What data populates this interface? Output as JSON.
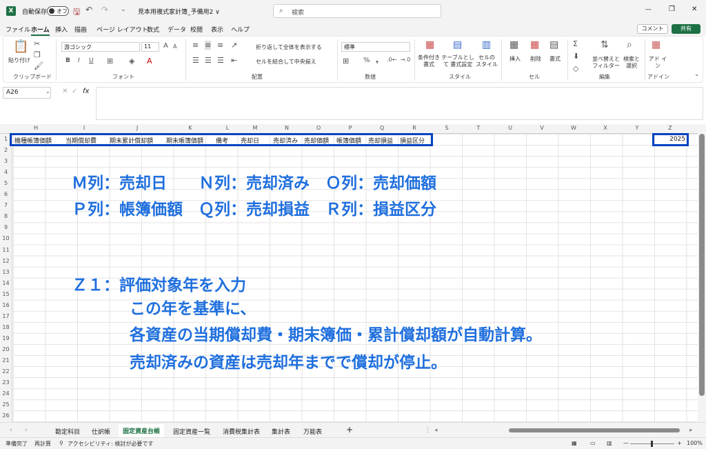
{
  "titlebar": {
    "app_icon": "X",
    "autosave_label": "自動保存",
    "toggle_state": "オフ",
    "file_title": "見本用複式家計簿_予備用2 ∨",
    "search_placeholder": "検索",
    "win_min": "—",
    "win_max": "❐",
    "win_close": "✕"
  },
  "menu": {
    "items": [
      "ファイル",
      "ホーム",
      "挿入",
      "描画",
      "ページ レイアウト",
      "数式",
      "データ",
      "校閲",
      "表示",
      "ヘルプ"
    ],
    "active": "ホーム",
    "comment_btn": "コメント",
    "share_btn": "共有"
  },
  "ribbon": {
    "clipboard": {
      "label": "クリップボード",
      "paste": "貼り付け"
    },
    "font": {
      "label": "フォント",
      "name": "游ゴシック",
      "size": "11",
      "bold": "B",
      "italic": "I",
      "underline": "U",
      "grow": "A",
      "shrink": "A"
    },
    "alignment": {
      "label": "配置",
      "wrap": "折り返して全体を表示する",
      "merge": "セルを結合して中央揃え"
    },
    "number": {
      "label": "数値",
      "format": "標準",
      "percent": "%",
      "comma": "❟"
    },
    "styles": {
      "label": "スタイル",
      "conditional": "条件付き 書式",
      "table": "テーブルとして 書式設定",
      "cell_styles": "セルの スタイル"
    },
    "cells": {
      "label": "セル",
      "insert": "挿入",
      "delete": "削除",
      "format": "書式"
    },
    "editing": {
      "label": "編集",
      "sort": "並べ替えと フィルター",
      "find": "検索と 選択"
    },
    "addin": {
      "label": "アドイン",
      "addin": "アド イン"
    }
  },
  "formula_bar": {
    "name_box": "A26",
    "fx": "fx",
    "content": ""
  },
  "columns": [
    "H",
    "I",
    "J",
    "K",
    "L",
    "M",
    "N",
    "O",
    "P",
    "Q",
    "R",
    "S",
    "T",
    "U",
    "V",
    "W",
    "X",
    "Y",
    "Z"
  ],
  "rows": [
    "1",
    "2",
    "3",
    "4",
    "5",
    "6",
    "7",
    "8",
    "9",
    "10",
    "11",
    "12",
    "13",
    "14",
    "15",
    "16",
    "17",
    "18",
    "19",
    "20",
    "21",
    "22",
    "23",
    "24",
    "25",
    "26"
  ],
  "row1_headers": [
    "機種帳簿価額",
    "当期償却費",
    "期末累計償却額",
    "期末帳簿価額",
    "備考",
    "売却日",
    "売却済み",
    "売却価額",
    "帳簿価額",
    "売却損益",
    "損益区分"
  ],
  "z1_value": "2025",
  "annotations": {
    "line1": "Ｍ列：売却日　　Ｎ列：売却済み　Ｏ列：売却価額",
    "line2": "Ｐ列：帳簿価額　Ｑ列：売却損益　Ｒ列：損益区分",
    "line3": "Ｚ１：評価対象年を入力",
    "line4": "この年を基準に、",
    "line5": "各資産の当期償却費・期末簿価・累計償却額が自動計算。",
    "line6": "売却済みの資産は売却年までで償却が停止。",
    "color": "#1f6fde"
  },
  "sheet_tabs": [
    "勘定科目",
    "仕訳帳",
    "固定資産台帳",
    "固定資産一覧",
    "消費税集計表",
    "集計表",
    "万能表"
  ],
  "active_tab": "固定資産台帳",
  "add_sheet": "+",
  "status": {
    "ready": "準備完了",
    "recalc": "再計算",
    "accessibility": "アクセシビリティ: 検討が必要です",
    "zoom": "100%"
  },
  "colors": {
    "accent": "#1e7145",
    "box": "#0042c0"
  }
}
